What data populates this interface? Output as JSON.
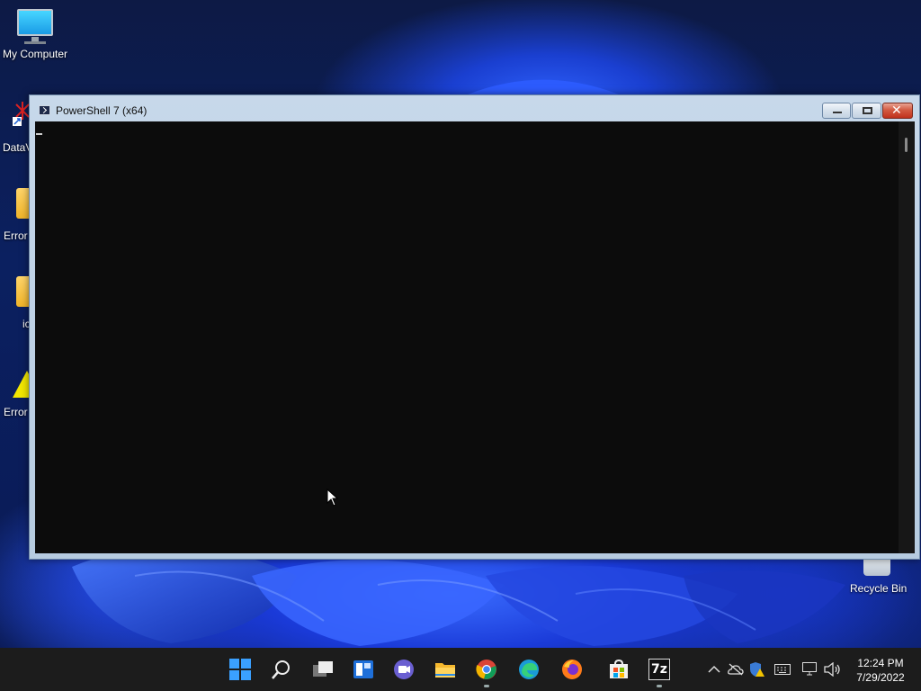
{
  "desktop": {
    "icons": [
      {
        "label": "My Computer",
        "icon": "computer-icon"
      },
      {
        "label": "DataV",
        "icon": "shortcut-icon"
      },
      {
        "label": "Error",
        "icon": "folder-icon"
      },
      {
        "label": "ic",
        "icon": "folder-icon"
      },
      {
        "label": "Error",
        "icon": "warning-icon"
      },
      {
        "label": "Recycle Bin",
        "icon": "recycle-bin-icon"
      }
    ]
  },
  "window": {
    "title": "PowerShell 7 (x64)",
    "buttons": {
      "minimize": "minimize",
      "maximize": "maximize",
      "close": "close"
    },
    "console_text": "",
    "colors": {
      "console_bg": "#0c0c0c",
      "frame": "#c7d8ea",
      "close": "#c0311c"
    }
  },
  "taskbar": {
    "icons": [
      {
        "name": "start-icon"
      },
      {
        "name": "search-icon"
      },
      {
        "name": "task-view-icon"
      },
      {
        "name": "widgets-icon"
      },
      {
        "name": "teams-chat-icon"
      },
      {
        "name": "file-explorer-icon"
      },
      {
        "name": "chrome-icon"
      },
      {
        "name": "edge-icon"
      },
      {
        "name": "firefox-icon"
      },
      {
        "name": "store-icon"
      },
      {
        "name": "7zip-icon",
        "label": "7z"
      }
    ],
    "tray": {
      "time": "12:24 PM",
      "date": "7/29/2022"
    }
  }
}
